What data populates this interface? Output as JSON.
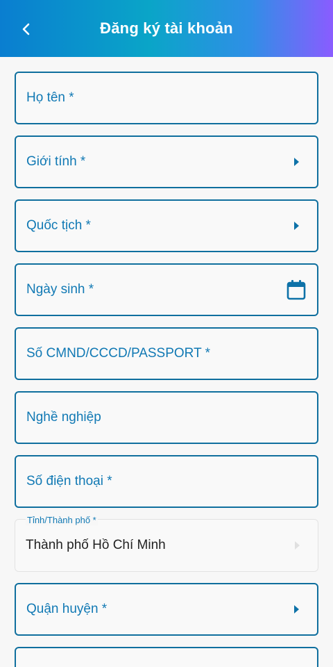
{
  "header": {
    "title": "Đăng ký tài khoản",
    "back_icon": "chevron-left-icon"
  },
  "fields": {
    "full_name": {
      "label": "Họ tên *"
    },
    "gender": {
      "label": "Giới tính *"
    },
    "nationality": {
      "label": "Quốc tịch *"
    },
    "birthdate": {
      "label": "Ngày sinh *",
      "icon": "calendar-icon"
    },
    "id_number": {
      "label": "Số CMND/CCCD/PASSPORT *"
    },
    "occupation": {
      "label": "Nghề nghiệp"
    },
    "phone": {
      "label": "Số điện thoại *"
    },
    "province": {
      "label": "Tỉnh/Thành phố *",
      "value": "Thành phố Hồ Chí Minh"
    },
    "district": {
      "label": "Quận huyện *"
    }
  },
  "colors": {
    "accent": "#1179b4",
    "border": "#0f6f9e",
    "header_gradient_start": "#0a7ed0",
    "header_gradient_end": "#8a5cff"
  }
}
